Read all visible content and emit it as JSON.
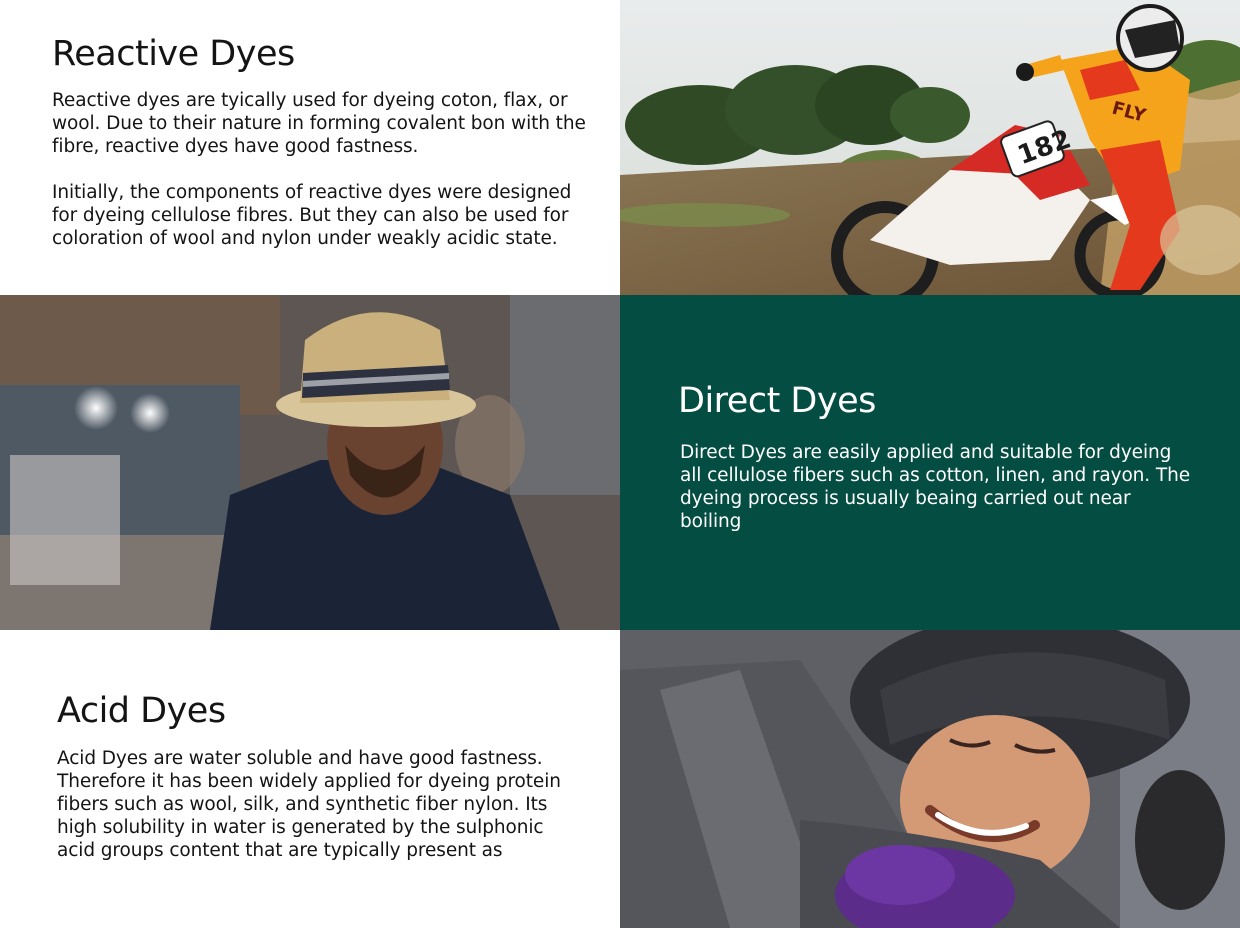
{
  "sections": [
    {
      "id": "reactive",
      "title": "Reactive Dyes",
      "paragraphs": [
        "Reactive dyes are tyically used for dyeing coton, flax, or wool. Due to their nature in forming covalent bon with the fibre, reactive dyes have good fastness.",
        "Initially, the components of reactive dyes were designed for dyeing cellulose fibres. But they can also be used for coloration of wool and nylon under weakly acidic state."
      ]
    },
    {
      "id": "direct",
      "title": "Direct Dyes",
      "paragraphs": [
        "Direct Dyes are easily applied and suitable for dyeing all cellulose fibers such as cotton, linen, and rayon. The dyeing process is usually beaing carried out near boiling"
      ]
    },
    {
      "id": "acid",
      "title": "Acid Dyes",
      "paragraphs": [
        "Acid Dyes are water soluble and have good fastness. Therefore it has been widely applied for dyeing protein fibers such as wool, silk, and synthetic fiber nylon. Its high solubility in water is generated by the sulphonic acid groups content that are typically present as"
      ]
    }
  ],
  "photos": {
    "motocross": {
      "rider_number": "182",
      "jersey_text": "FLY"
    }
  },
  "colors": {
    "accent_panel": "#044d43",
    "text_dark": "#141414",
    "text_light": "#ffffff"
  }
}
